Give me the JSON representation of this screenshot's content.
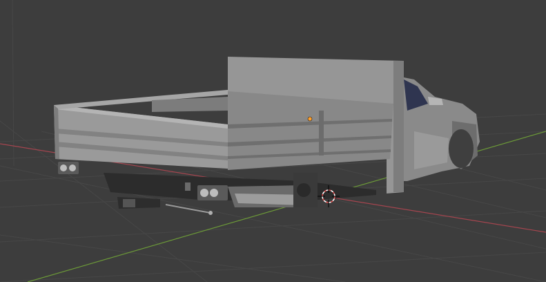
{
  "app": {
    "name": ""
  },
  "viewport": {
    "mode": "3d-viewport-solid-shading",
    "background_color": "#3d3d3d",
    "grid_color": "#474747",
    "x_axis_color": "#a5454f",
    "y_axis_color": "#6c9a38",
    "object_origin_color": "#ff9f2a",
    "cursor_icon": "3d-cursor-icon",
    "scene_object": "pickup-truck-model-with-flatbed"
  }
}
